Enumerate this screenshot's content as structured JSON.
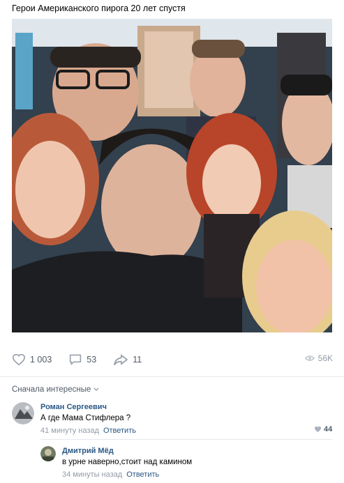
{
  "post": {
    "text": "Герои Американского пирога 20 лет спустя"
  },
  "actions": {
    "likes": "1 003",
    "comments": "53",
    "shares": "11",
    "views": "56K"
  },
  "comments_sort": "Сначала интересные",
  "comments": [
    {
      "author": "Роман Сергеевич",
      "text": "А где Мама Стифлера ?",
      "time": "41 минуту назад",
      "reply_label": "Ответить",
      "likes": "44"
    },
    {
      "author": "Дмитрий Мёд",
      "text": "в урне наверно,стоит над камином",
      "time": "34 минуты назад",
      "reply_label": "Ответить"
    }
  ],
  "colors": {
    "link": "#2a5885",
    "muted": "#939ba6",
    "icon": "#99a2ad"
  }
}
